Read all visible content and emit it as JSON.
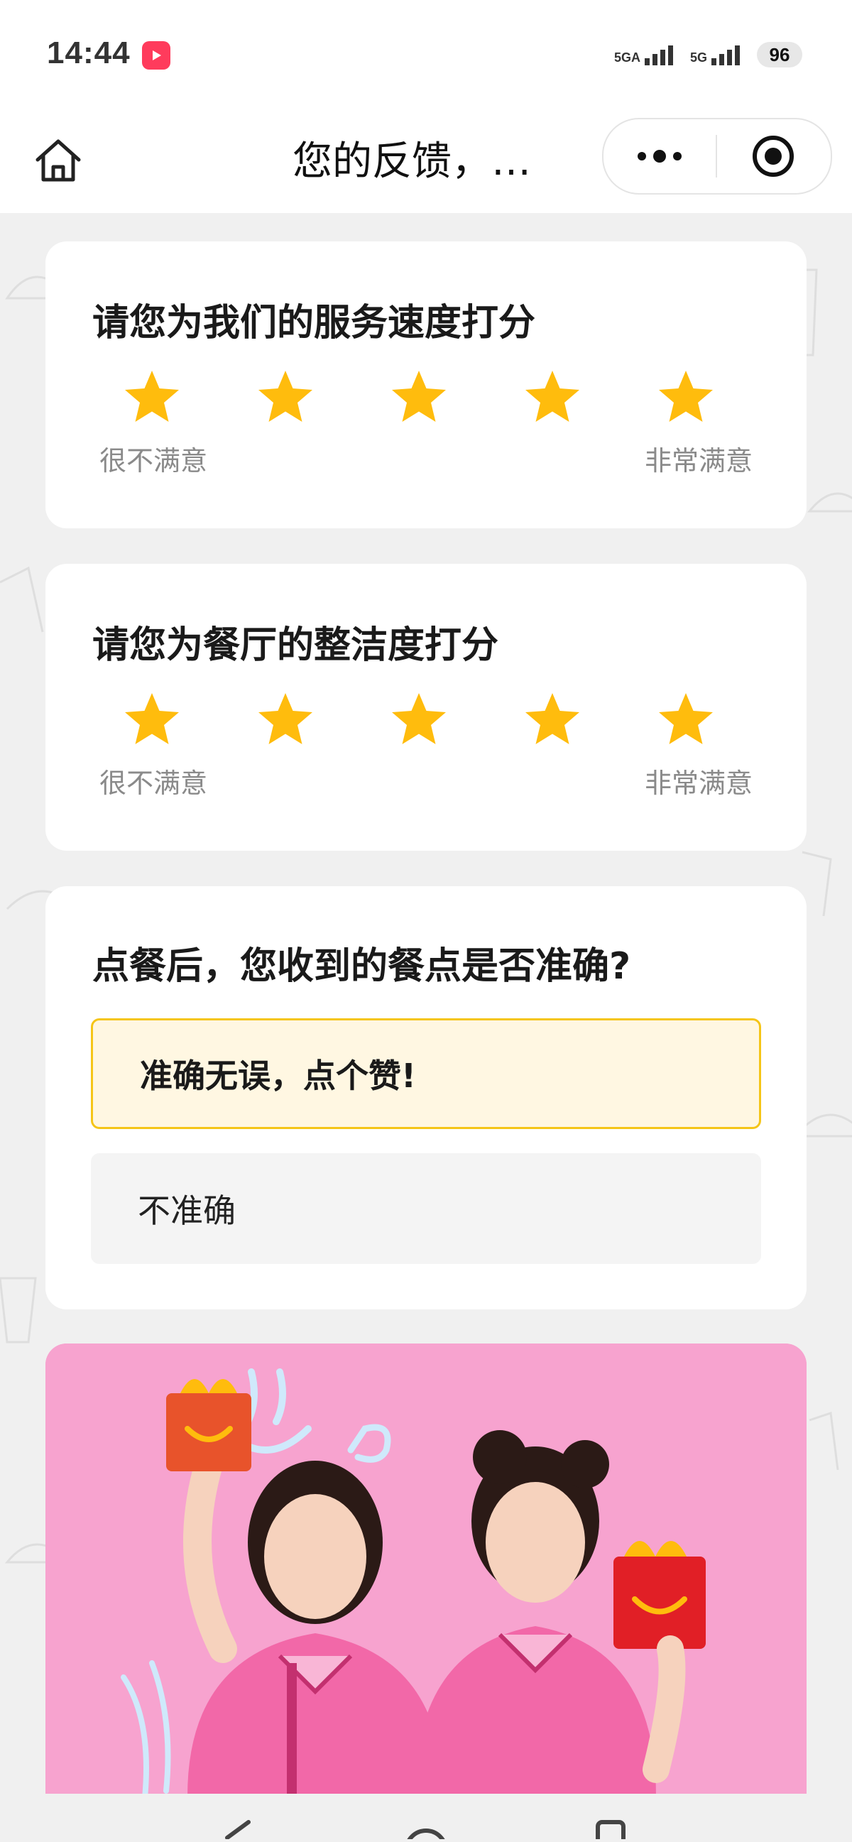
{
  "status_bar": {
    "time": "14:44",
    "network_1": "5GA",
    "network_2": "5G",
    "battery": "96"
  },
  "nav_bar": {
    "title": "您的反馈，…",
    "more_icon": "more-dots-icon",
    "close_icon": "target-close-icon",
    "home_icon": "home-icon"
  },
  "rating_cards": [
    {
      "title": "请您为我们的服务速度打分",
      "stars": 5,
      "max_stars": 5,
      "min_label": "很不满意",
      "max_label": "非常满意"
    },
    {
      "title": "请您为餐厅的整洁度打分",
      "stars": 5,
      "max_stars": 5,
      "min_label": "很不满意",
      "max_label": "非常满意"
    }
  ],
  "accuracy_card": {
    "title": "点餐后，您收到的餐点是否准确?",
    "options": [
      {
        "label": "准确无误，点个赞!",
        "selected": true
      },
      {
        "label": "不准确",
        "selected": false
      }
    ]
  },
  "colors": {
    "star": "#ffbc0d",
    "selected_border": "#f5c518",
    "selected_bg": "#fff7e2",
    "promo_bg": "#f7a3cf"
  }
}
